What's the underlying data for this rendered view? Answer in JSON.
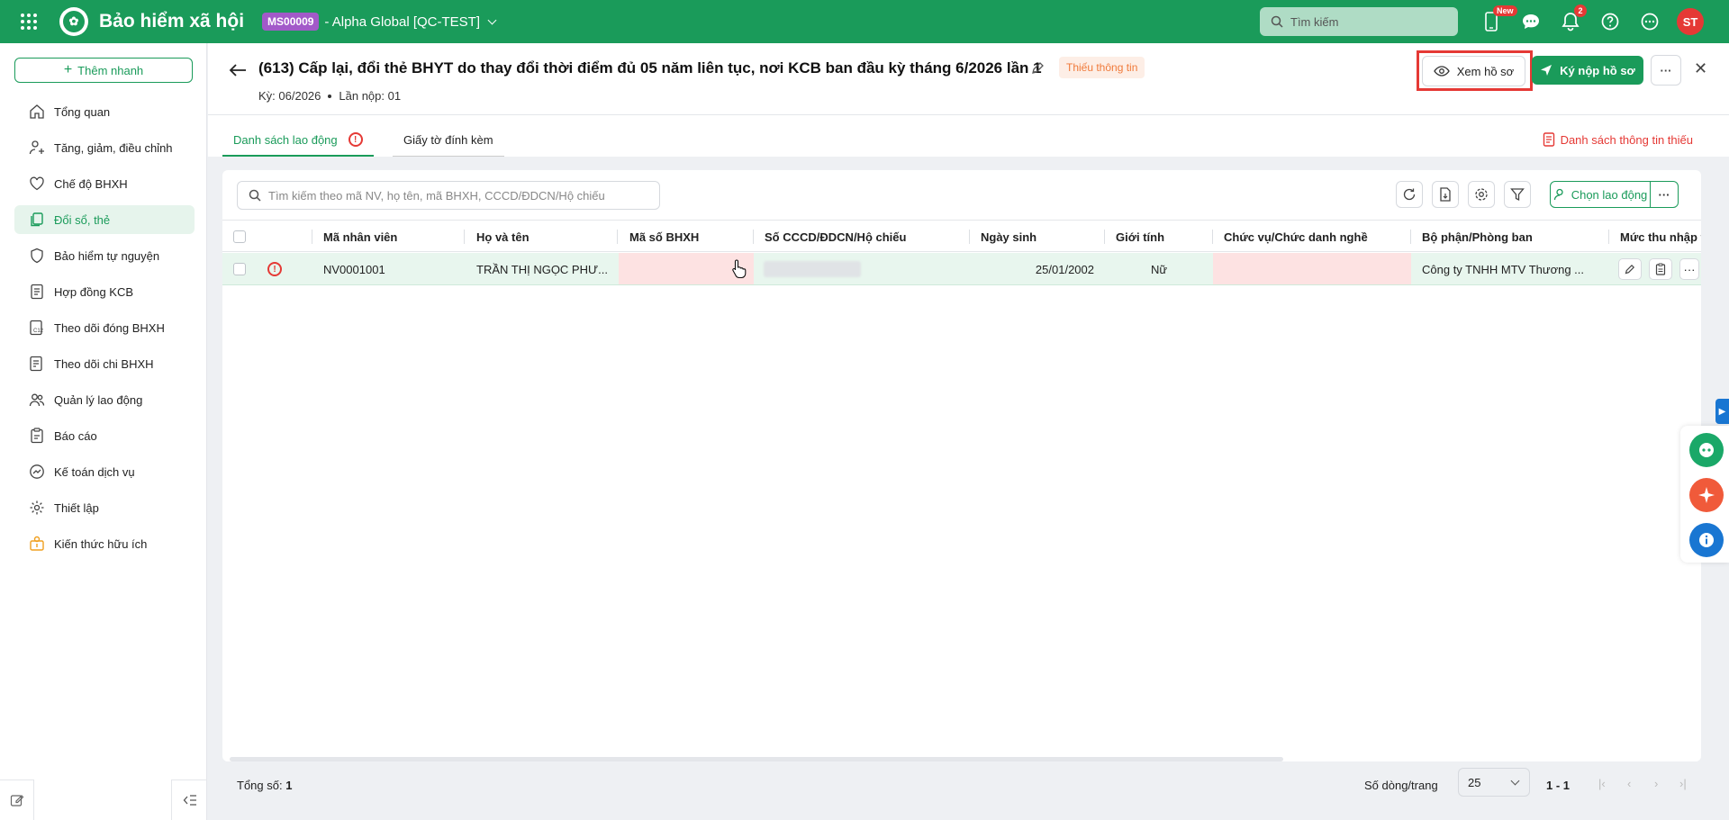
{
  "topbar": {
    "app_title": "Bảo hiểm xã hội",
    "tenant_code": "MS00009",
    "tenant_name": "- Alpha Global [QC-TEST]",
    "search_placeholder": "Tìm kiếm",
    "new_badge": "New",
    "notification_count": "2",
    "avatar_initials": "ST"
  },
  "sidebar": {
    "quick_add": "Thêm nhanh",
    "items": [
      {
        "label": "Tổng quan",
        "icon": "home-icon"
      },
      {
        "label": "Tăng, giảm, điều chỉnh",
        "icon": "user-adjust-icon"
      },
      {
        "label": "Chế độ BHXH",
        "icon": "heart-icon"
      },
      {
        "label": "Đổi sổ, thẻ",
        "icon": "cards-icon"
      },
      {
        "label": "Bảo hiểm tự nguyện",
        "icon": "shield-icon"
      },
      {
        "label": "Hợp đồng KCB",
        "icon": "contract-icon"
      },
      {
        "label": "Theo dõi đóng BHXH",
        "icon": "c12-icon"
      },
      {
        "label": "Theo dõi chi BHXH",
        "icon": "payout-icon"
      },
      {
        "label": "Quản lý lao động",
        "icon": "people-icon"
      },
      {
        "label": "Báo cáo",
        "icon": "report-icon"
      },
      {
        "label": "Kế toán dịch vụ",
        "icon": "accounting-icon"
      },
      {
        "label": "Thiết lập",
        "icon": "gear-icon"
      },
      {
        "label": "Kiến thức hữu ích",
        "icon": "knowledge-icon"
      }
    ]
  },
  "header": {
    "title": "(613) Cấp lại, đổi thẻ BHYT do thay đổi thời điểm đủ 05 năm liên tục, nơi KCB ban đầu kỳ tháng 6/2026 lần 1",
    "status_badge": "Thiếu thông tin",
    "period": "Kỳ: 06/2026",
    "submission": "Lần nộp: 01",
    "view_button": "Xem hồ sơ",
    "submit_button": "Ký nộp hồ sơ"
  },
  "tabs": {
    "employees": "Danh sách lao động",
    "attachments": "Giấy tờ đính kèm",
    "missing_info_link": "Danh sách thông tin thiếu"
  },
  "table": {
    "search_placeholder": "Tìm kiếm theo mã NV, họ tên, mã BHXH, CCCD/ĐDCN/Hộ chiếu",
    "choose_button": "Chọn lao động",
    "columns": [
      "Mã nhân viên",
      "Họ và tên",
      "Mã số BHXH",
      "Số CCCD/ĐDCN/Hộ chiếu",
      "Ngày sinh",
      "Giới tính",
      "Chức vụ/Chức danh nghề",
      "Bộ phận/Phòng ban",
      "Mức thu nhập thá"
    ],
    "rows": [
      {
        "employee_code": "NV0001001",
        "full_name": "TRẦN THỊ NGỌC PHƯ...",
        "social_insurance_code": "",
        "id_number": "",
        "birth_date": "25/01/2002",
        "gender": "Nữ",
        "position": "",
        "department": "Công ty TNHH MTV Thương ..."
      }
    ]
  },
  "footer": {
    "total_label": "Tổng số:",
    "total_value": "1",
    "rows_per_page_label": "Số dòng/trang",
    "rows_per_page": "25",
    "page_range": "1 - 1"
  },
  "colors": {
    "brand": "#1a9b5a",
    "danger": "#e53935",
    "warning": "#f07a3a",
    "info": "#1976d2"
  }
}
